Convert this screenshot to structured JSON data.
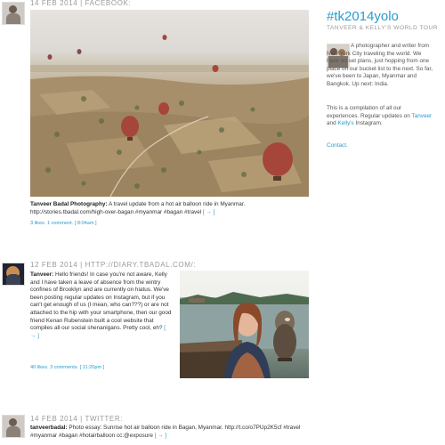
{
  "posts": [
    {
      "meta": "14 FEB 2014 | FACEBOOK:",
      "author": "Tanveer Badal Photography:",
      "text": " A travel update from a hot air balloon ride in Myanmar. http://stories.tbadal.com/high-over-bagan #myanmar #bagan #travel ",
      "arrow": "[ → ]",
      "stats": "3 likes. 1 comment. [ 8:04am ]"
    },
    {
      "meta": "12 FEB 2014 | HTTP://DIARY.TBADAL.COM/:",
      "author": "Tanveer:",
      "text": " Hello friends! In case you're not aware, Kelly and I have taken a leave of absence from the wintry confines of Brooklyn and are currently on hiatus.  We've been posting regular updates on Instagram, but if you can't get enough of us (I mean, who can???) or are not attached to the hip with your smartphone, then our good friend Kenan Rubenstein built a cool website that compiles all our social shenanigans.  Pretty cool, eh? ",
      "arrow": "[ → ]",
      "stats": "40 likes. 3 comments. [ 11:20pm ]"
    },
    {
      "meta": "14 FEB 2014 | TWITTER:",
      "author": "tanveerbadal:",
      "text": " Photo essay: Sunrise hot air balloon ride in Bagan, Myanmar. http://t.co/o7PUp2K5cf #travel #myanmar #bagan #hotairballoon cc:@exposure ",
      "arrow": "[ → ]"
    }
  ],
  "sidebar": {
    "title": "#tk2014yolo",
    "subtitle": "TANVEER & KELLY'S WORLD TOUR",
    "bio": "A photographer and writer from New York City traveling the world. We have no set plans, just hopping from one place on our bucket list to the next. So far, we've been to Japan, Myanmar and Bangkok. Up next: India.",
    "compilation_pre": "This is a compilation of all our experiences. Regular updates on ",
    "link_tanveer": "Tanveer",
    "and": " and ",
    "link_kelly": "Kelly's",
    "compilation_post": " Instagram.",
    "contact": "Contact."
  },
  "colors": {
    "accent": "#2a9ccd",
    "meta": "#9a9a9a"
  }
}
